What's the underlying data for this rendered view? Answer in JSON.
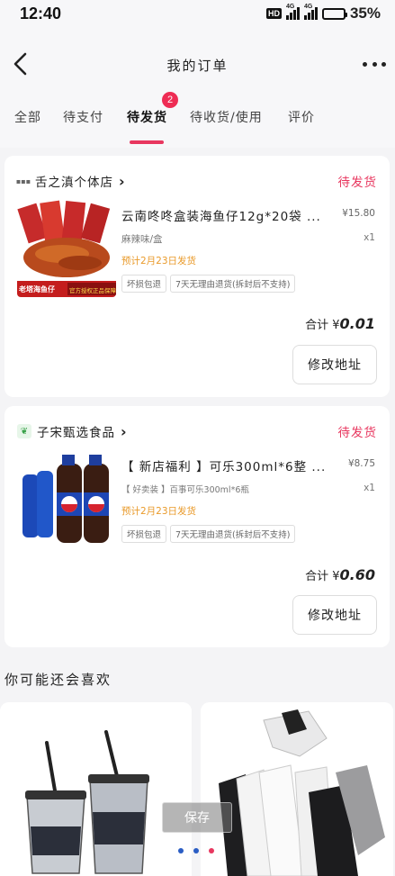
{
  "status_bar": {
    "time": "12:40",
    "hd": "HD",
    "sig1": "4G",
    "sig2": "4G",
    "battery": "35%"
  },
  "header": {
    "title": "我的订单"
  },
  "tabs": [
    {
      "label": "全部"
    },
    {
      "label": "待支付"
    },
    {
      "label": "待发货",
      "badge": "2"
    },
    {
      "label": "待收货/使用"
    },
    {
      "label": "评价"
    }
  ],
  "orders": [
    {
      "store": "舌之滇个体店",
      "status": "待发货",
      "title": "云南咚咚盒装海鱼仔12g*20袋 ...",
      "price": "¥15.80",
      "spec": "麻辣味/盒",
      "qty": "x1",
      "ship": "预计2月23日发货",
      "tags": [
        "坏损包退",
        "7天无理由退货(拆封后不支持)"
      ],
      "total_label": "合计 ¥",
      "total_value": "0.01",
      "button": "修改地址",
      "img_text": [
        "老塔海鱼仔",
        "官方授权正品保障"
      ]
    },
    {
      "store": "子宋甄选食品",
      "status": "待发货",
      "title": "【 新店福利 】可乐300ml*6整 ...",
      "price": "¥8.75",
      "spec": "【 好卖装 】百事可乐300ml*6瓶",
      "qty": "x1",
      "ship": "预计2月23日发货",
      "tags": [
        "坏损包退",
        "7天无理由退货(拆封后不支持)"
      ],
      "total_label": "合计 ¥",
      "total_value": "0.60",
      "button": "修改地址"
    }
  ],
  "recommend": {
    "title": "你可能还会喜欢"
  },
  "overlay": {
    "save": "保存"
  },
  "colors": {
    "accent": "#e8375f",
    "ship": "#e99a2a"
  }
}
